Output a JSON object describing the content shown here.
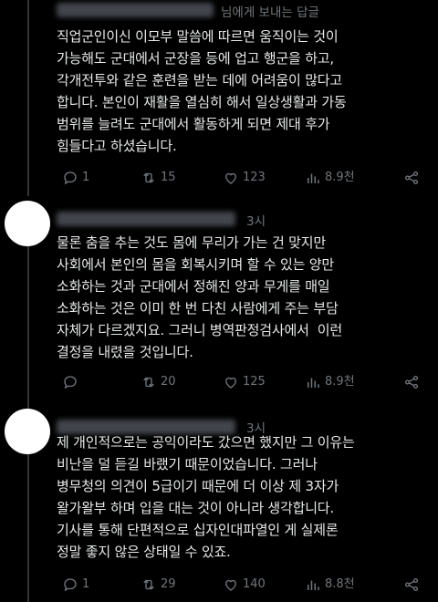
{
  "tweets": [
    {
      "reply_to": "님에게 보내는 답글",
      "text": "직업군인이신 이모부 말씀에 따르면 움직이는 것이\n가능해도 군대에서 군장을 등에 업고 행군을 하고,\n각개전투와 같은 훈련을 받는 데에 어려움이 많다고\n합니다. 본인이 재활을 열심히 해서 일상생활과 가동\n범위를 늘려도 군대에서 활동하게 되면 제대 후가\n힘들다고 하셨습니다.",
      "actions": {
        "reply": "1",
        "retweet": "15",
        "like": "123",
        "views": "8.9천"
      }
    },
    {
      "time": "3시",
      "text": "물론 춤을 추는 것도 몸에 무리가 가는 건 맞지만\n사회에서 본인의 몸을 회복시키며 할 수 있는 양만\n소화하는 것과 군대에서 정해진 양과 무게를 매일\n소화하는 것은 이미 한 번 다친 사람에게 주는 부담\n자체가 다르겠지요. 그러니 병역판정검사에서  이런\n결정을 내렸을 것입니다.",
      "actions": {
        "reply": "",
        "retweet": "20",
        "like": "125",
        "views": "8.9천"
      }
    },
    {
      "time": "3시",
      "text": "제 개인적으로는 공익이라도 갔으면 했지만 그 이유는\n비난을 덜 듣길 바랬기 때문이었습니다. 그러나\n병무청의 의견이 5급이기 때문에 더 이상 제 3자가\n왈가왈부 하며 입을 대는 것이 아니라 생각합니다.\n기사를 통해 단편적으로 십자인대파열인 게 실제론\n정말 좋지 않은 상태일 수 있죠.",
      "actions": {
        "reply": "1",
        "retweet": "29",
        "like": "140",
        "views": "8.8천"
      }
    }
  ]
}
